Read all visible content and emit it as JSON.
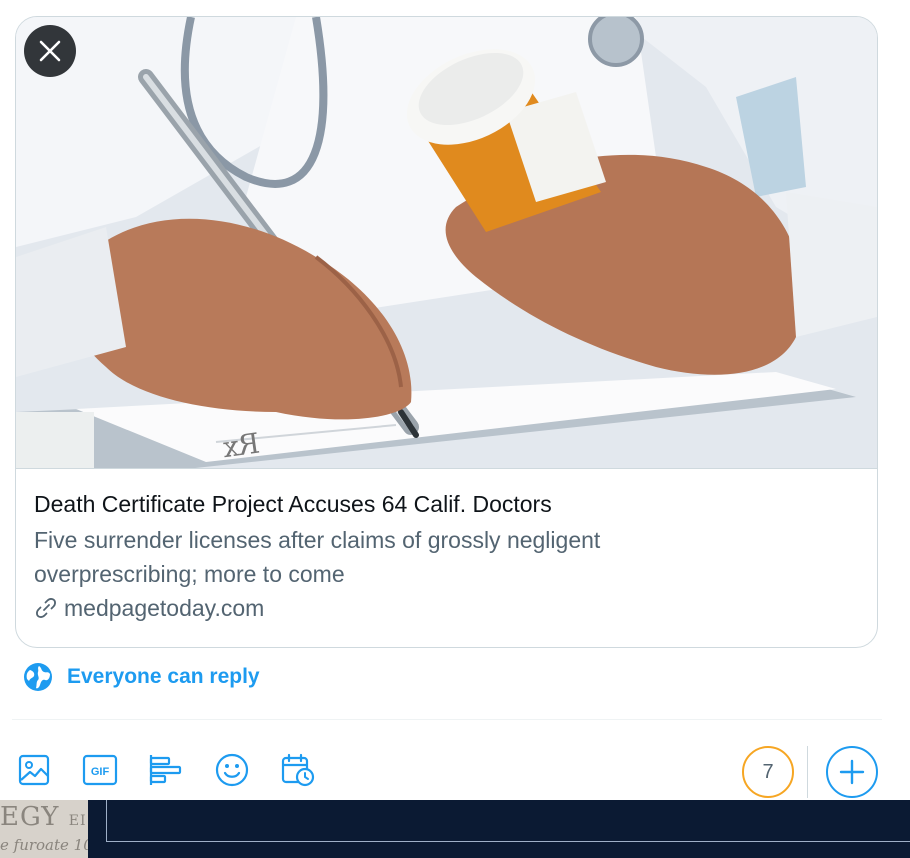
{
  "card": {
    "image_alt": "Doctor writing a prescription while holding a pill bottle",
    "title": "Death Certificate Project Accuses 64 Calif. Doctors",
    "description_line1": "Five surrender licenses after claims of grossly negligent",
    "description_line2": "overprescribing; more to come",
    "domain": "medpagetoday.com"
  },
  "reply_setting": {
    "label": "Everyone can reply"
  },
  "toolbar": {
    "items": [
      "image-icon",
      "gif-icon",
      "poll-icon",
      "emoji-icon",
      "schedule-icon"
    ],
    "gif_label": "GIF"
  },
  "counter": {
    "remaining": "7"
  },
  "background_strip": {
    "text_top": "EGY",
    "text_top_small": "EI",
    "text_bottom": "e furoate 10"
  },
  "colors": {
    "accent": "#1d9bf0",
    "counter_ring": "#f6a623",
    "title_text": "#0f1419",
    "secondary_text": "#536471"
  }
}
